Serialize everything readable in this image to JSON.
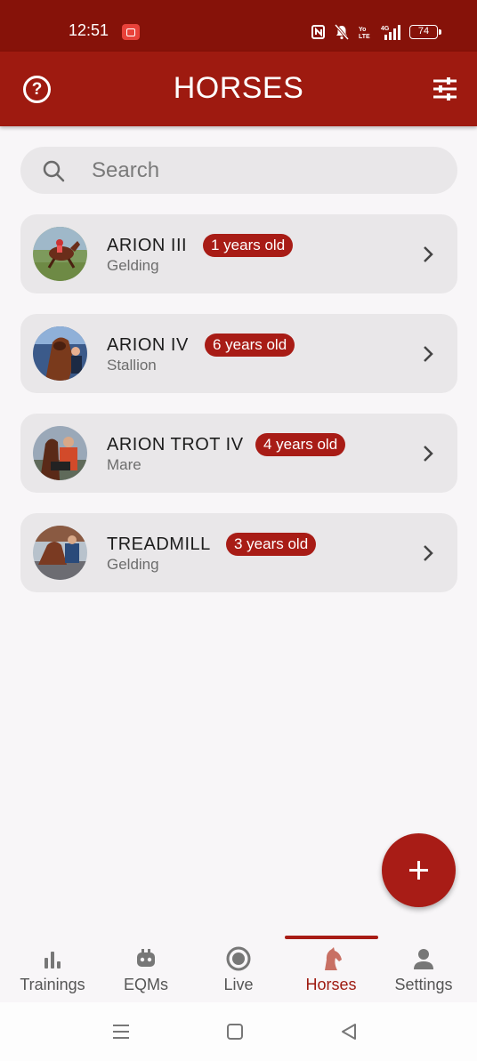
{
  "status_bar": {
    "time": "12:51",
    "battery": "74",
    "network": "4G"
  },
  "app_bar": {
    "title": "HORSES",
    "help_icon": "help-circle-icon",
    "filter_icon": "sliders-icon"
  },
  "search": {
    "placeholder": "Search",
    "value": ""
  },
  "horses": [
    {
      "name": "ARION III",
      "type": "Gelding",
      "age": "1 years old"
    },
    {
      "name": "ARION IV",
      "type": "Stallion",
      "age": "6 years old"
    },
    {
      "name": "ARION TROT IV",
      "type": "Mare",
      "age": "4 years old"
    },
    {
      "name": "TREADMILL",
      "type": "Gelding",
      "age": "3 years old"
    }
  ],
  "fab": {
    "icon": "plus-icon"
  },
  "bottom_nav": {
    "items": [
      {
        "label": "Trainings",
        "icon": "bar-chart-icon"
      },
      {
        "label": "EQMs",
        "icon": "device-icon"
      },
      {
        "label": "Live",
        "icon": "record-icon"
      },
      {
        "label": "Horses",
        "icon": "horse-head-icon"
      },
      {
        "label": "Settings",
        "icon": "person-icon"
      }
    ],
    "active": "Horses"
  },
  "colors": {
    "status_bar": "#861209",
    "app_bar": "#9e1a10",
    "accent": "#a81c16",
    "card": "#e9e7e9",
    "background": "#f8f6f8"
  }
}
